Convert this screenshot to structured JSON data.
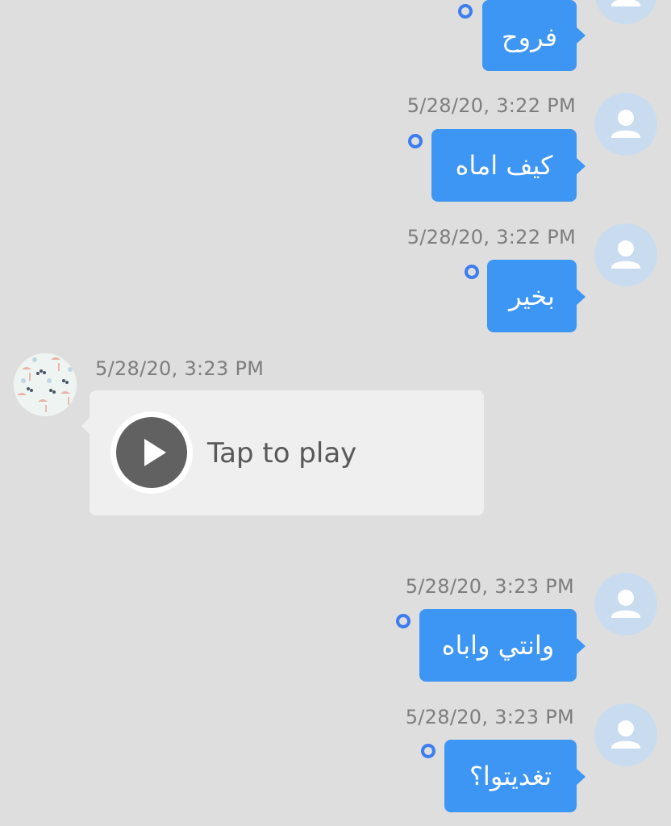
{
  "conversation": {
    "messages": [
      {
        "sender": "me",
        "timestamp": "",
        "text": "فروح",
        "delivered": true
      },
      {
        "sender": "me",
        "timestamp": "5/28/20, 3:22 PM",
        "text": "كيف اماه",
        "delivered": true
      },
      {
        "sender": "me",
        "timestamp": "5/28/20, 3:22 PM",
        "text": "بخير",
        "delivered": true
      },
      {
        "sender": "other",
        "timestamp": "5/28/20, 3:23 PM",
        "type": "voice",
        "voice_label": "Tap to play",
        "play_icon": "play-icon"
      },
      {
        "sender": "me",
        "timestamp": "5/28/20, 3:23 PM",
        "text": "وانتي واباه",
        "delivered": true
      },
      {
        "sender": "me",
        "timestamp": "5/28/20, 3:23 PM",
        "text": "تغديتوا؟",
        "delivered": true
      }
    ]
  },
  "colors": {
    "background": "#dedede",
    "sent_bubble": "#3d95f4",
    "received_bubble": "#efefef",
    "timestamp_text": "#7d7d7d",
    "avatar_placeholder": "#c9dcef",
    "status_dot": "#3d7df0"
  },
  "icons": {
    "my_avatar": "user-silhouette-icon",
    "other_avatar": "flamingo-pattern-avatar",
    "status": "sent-status-ring-icon"
  }
}
